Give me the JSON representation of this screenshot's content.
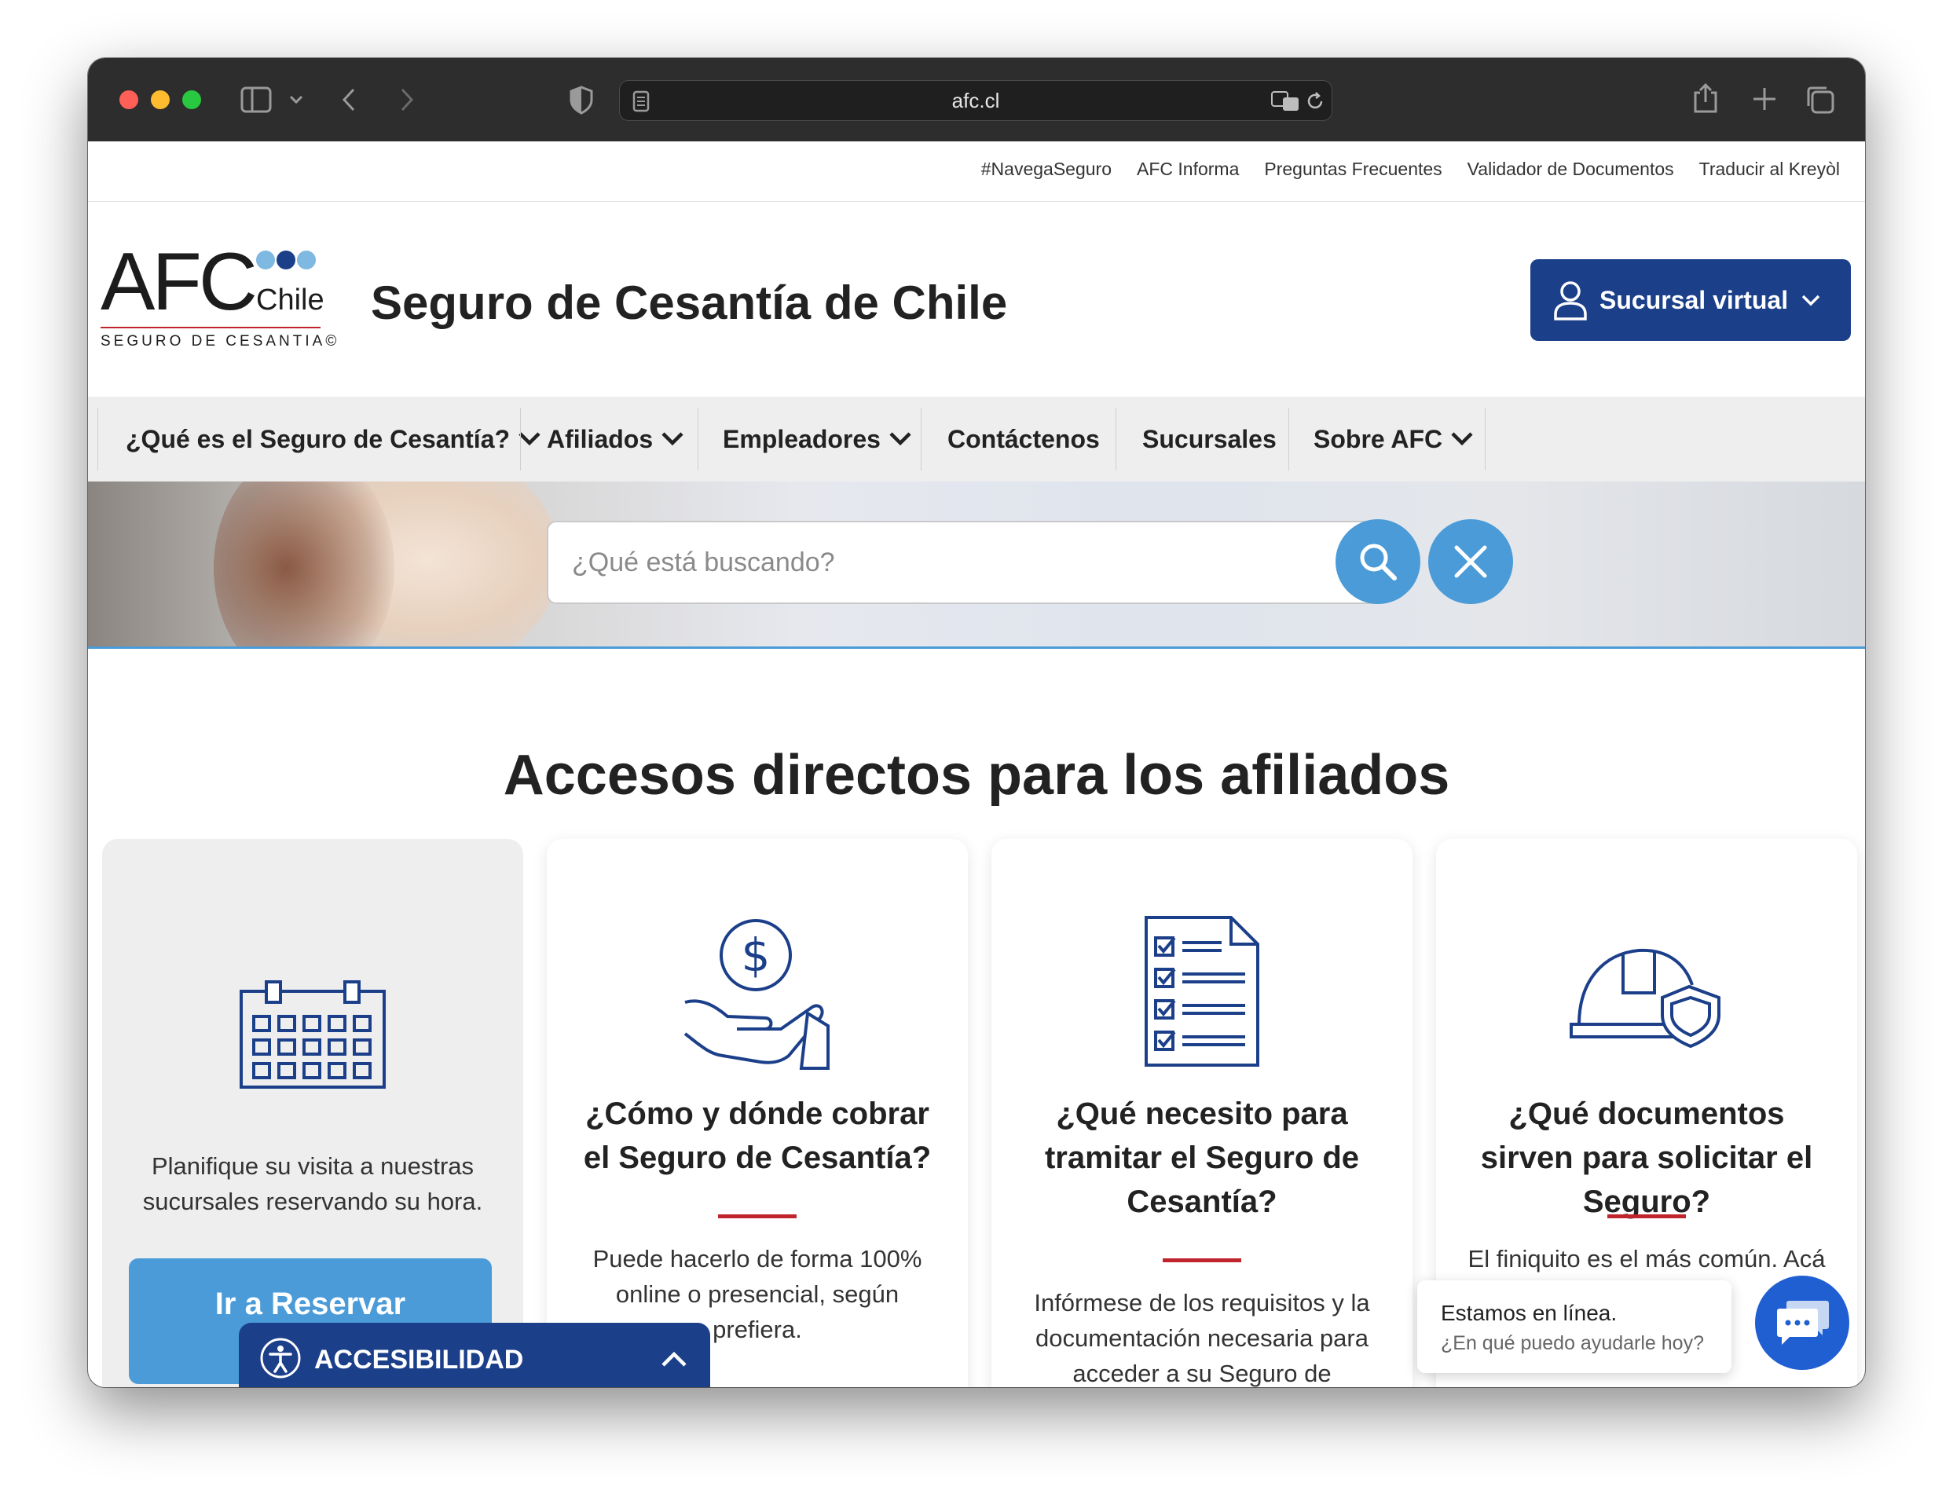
{
  "browser": {
    "url": "afc.cl"
  },
  "topbar": {
    "links": [
      "#NavegaSeguro",
      "AFC Informa",
      "Preguntas Frecuentes",
      "Validador de Documentos",
      "Traducir al Kreyòl"
    ]
  },
  "header": {
    "logo_afc": "AFC",
    "logo_chile": "Chile",
    "logo_sub": "SEGURO DE CESANTIA©",
    "site_title": "Seguro de Cesantía de Chile",
    "sucursal_label": "Sucursal virtual"
  },
  "nav": {
    "items": [
      "¿Qué es el Seguro de Cesantía?",
      "Afiliados",
      "Empleadores",
      "Contáctenos",
      "Sucursales",
      "Sobre AFC"
    ]
  },
  "search": {
    "placeholder": "¿Qué está buscando?"
  },
  "section": {
    "title": "Accesos directos para los afiliados"
  },
  "cards": [
    {
      "icon": "calendar-icon",
      "body": "Planifique su visita a nuestras sucursales reservando su hora.",
      "button": "Ir a Reservar"
    },
    {
      "icon": "money-hand-icon",
      "title": "¿Cómo y dónde cobrar el Seguro de Cesantía?",
      "body": "Puede hacerlo de forma 100% online o presencial, según prefiera."
    },
    {
      "icon": "checklist-document-icon",
      "title": "¿Qué necesito para tramitar el Seguro de Cesantía?",
      "body": "Infórmese de los requisitos y la documentación necesaria para acceder a su Seguro de Cesantía"
    },
    {
      "icon": "helmet-shield-icon",
      "title": "¿Qué documentos sirven para solicitar el Seguro?",
      "body": "El finiquito es el más común. Acá"
    }
  ],
  "accessibility": {
    "label": "ACCESIBILIDAD"
  },
  "chat": {
    "line1": "Estamos en línea.",
    "line2": "¿En qué puedo ayudarle hoy?"
  },
  "colors": {
    "brand_blue": "#1c3f8a",
    "light_blue": "#4a9bd8",
    "accent_red": "#c0242c",
    "chat_blue": "#1f5fd1"
  }
}
